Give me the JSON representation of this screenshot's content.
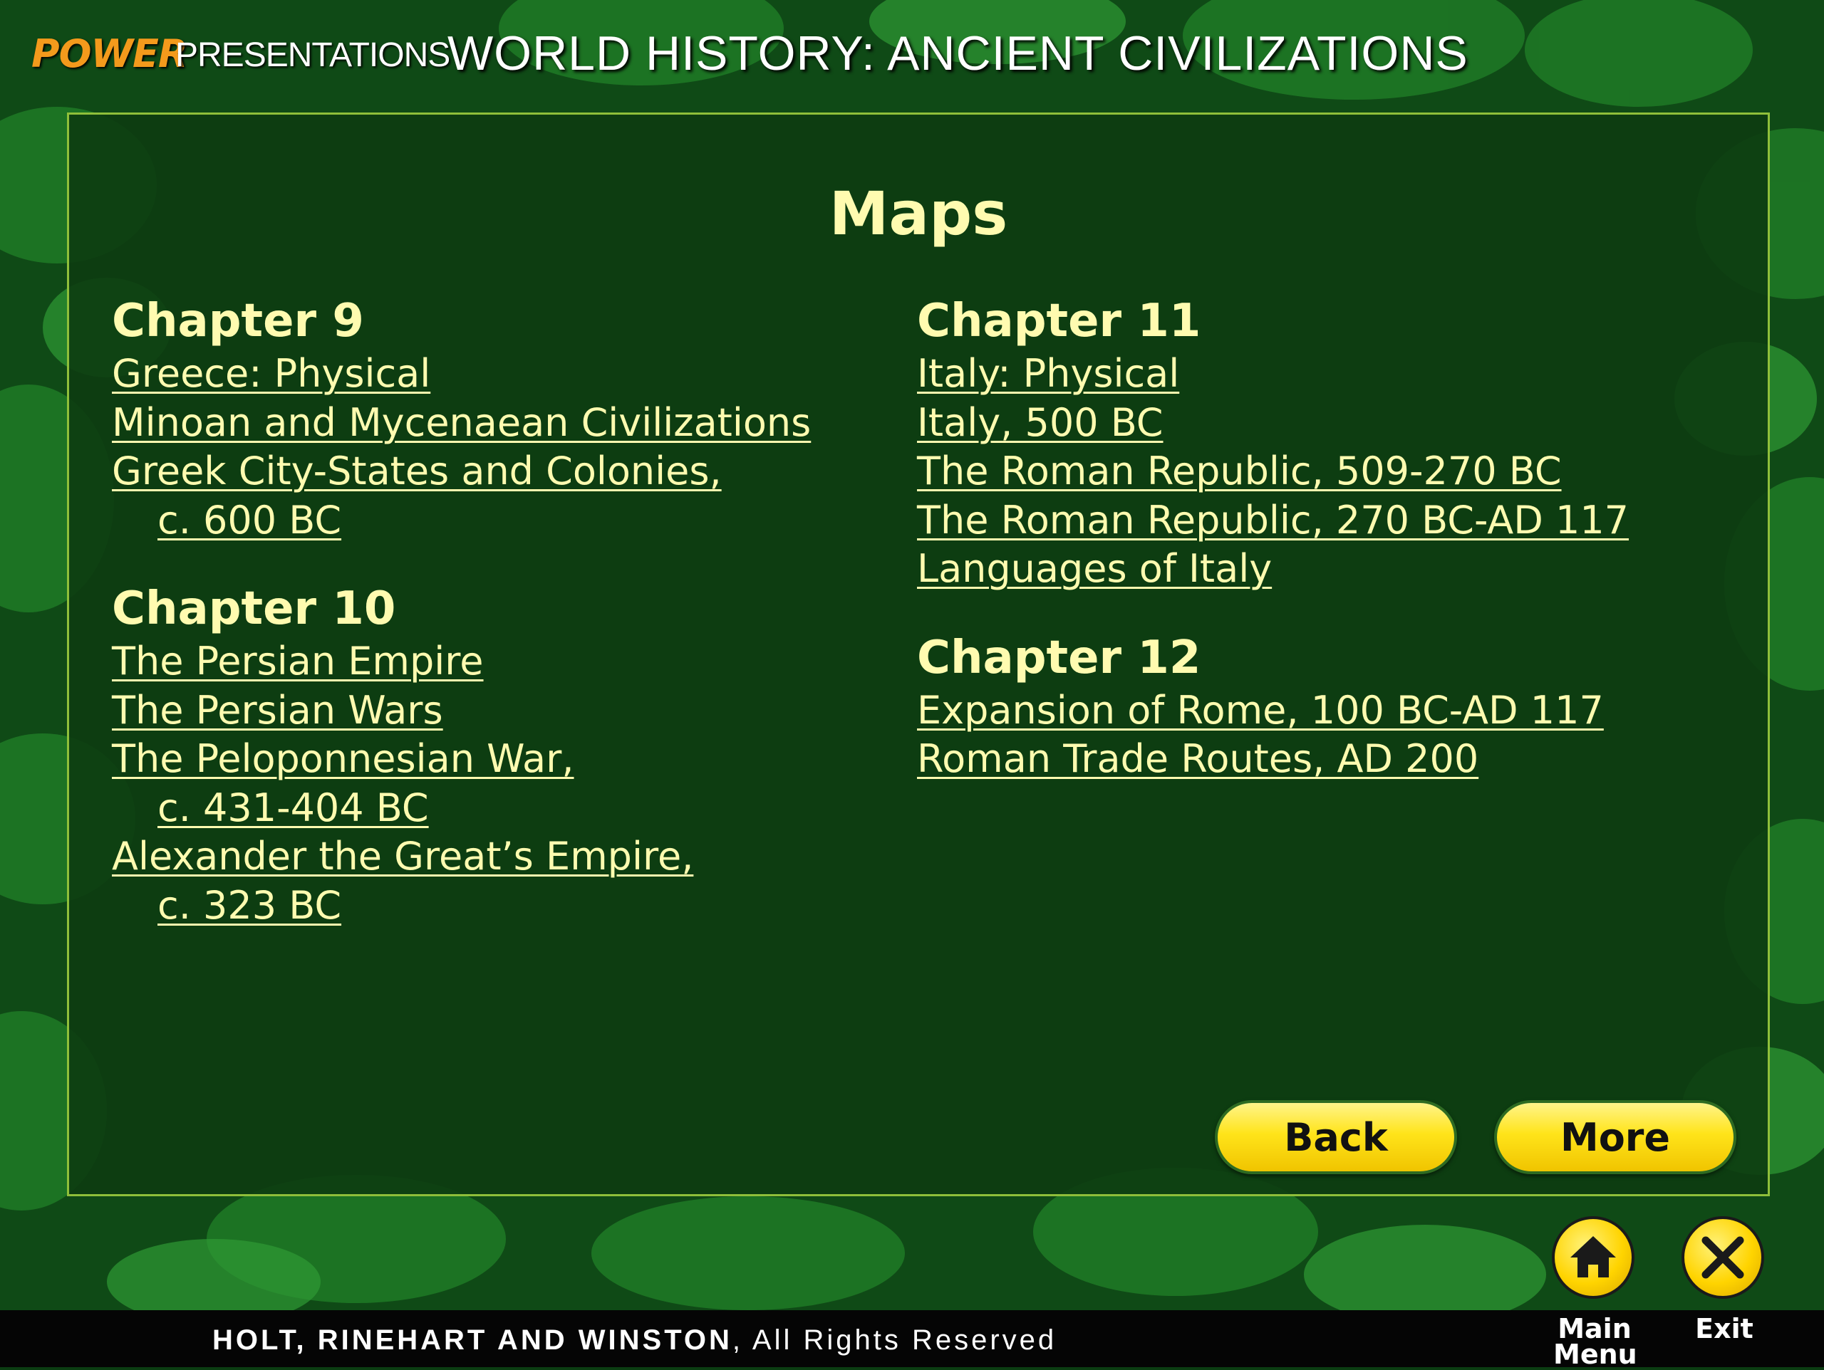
{
  "header": {
    "brand_power": "POWER",
    "brand_presentations": "PRESENTATIONS",
    "course_title": "WORLD HISTORY: ANCIENT CIVILIZATIONS"
  },
  "panel": {
    "title": "Maps",
    "left_column": {
      "chapter9": {
        "heading": "Chapter 9",
        "links": [
          {
            "label": "Greece: Physical"
          },
          {
            "label": "Minoan and Mycenaean Civilizations"
          },
          {
            "label": "Greek City-States and Colonies,",
            "cont": "c. 600 BC"
          }
        ]
      },
      "chapter10": {
        "heading": "Chapter 10",
        "links": [
          {
            "label": "The Persian Empire"
          },
          {
            "label": "The Persian Wars"
          },
          {
            "label": "The Peloponnesian War,",
            "cont": "c. 431-404 BC"
          },
          {
            "label": "Alexander the Great’s Empire,",
            "cont": "c. 323 BC"
          }
        ]
      }
    },
    "right_column": {
      "chapter11": {
        "heading": "Chapter 11",
        "links": [
          {
            "label": "Italy: Physical"
          },
          {
            "label": "Italy, 500 BC"
          },
          {
            "label": "The Roman Republic, 509-270 BC"
          },
          {
            "label": "The Roman Republic, 270 BC-AD 117"
          },
          {
            "label": "Languages of Italy"
          }
        ]
      },
      "chapter12": {
        "heading": "Chapter 12",
        "links": [
          {
            "label": "Expansion of Rome, 100 BC-AD 117"
          },
          {
            "label": "Roman Trade Routes, AD 200"
          }
        ]
      }
    },
    "buttons": {
      "back": "Back",
      "more": "More"
    }
  },
  "footer": {
    "publisher": "HOLT, RINEHART AND WINSTON",
    "rights": ", All Rights Reserved",
    "main_menu_line1": "Main",
    "main_menu_line2": "Menu",
    "exit": "Exit"
  },
  "colors": {
    "text_accent": "#fffbb0",
    "button_yellow": "#ffe41a",
    "panel_border": "#8fbf3a",
    "brand_orange": "#f39a1c"
  },
  "icons": {
    "home": "home-icon",
    "exit": "close-icon"
  }
}
